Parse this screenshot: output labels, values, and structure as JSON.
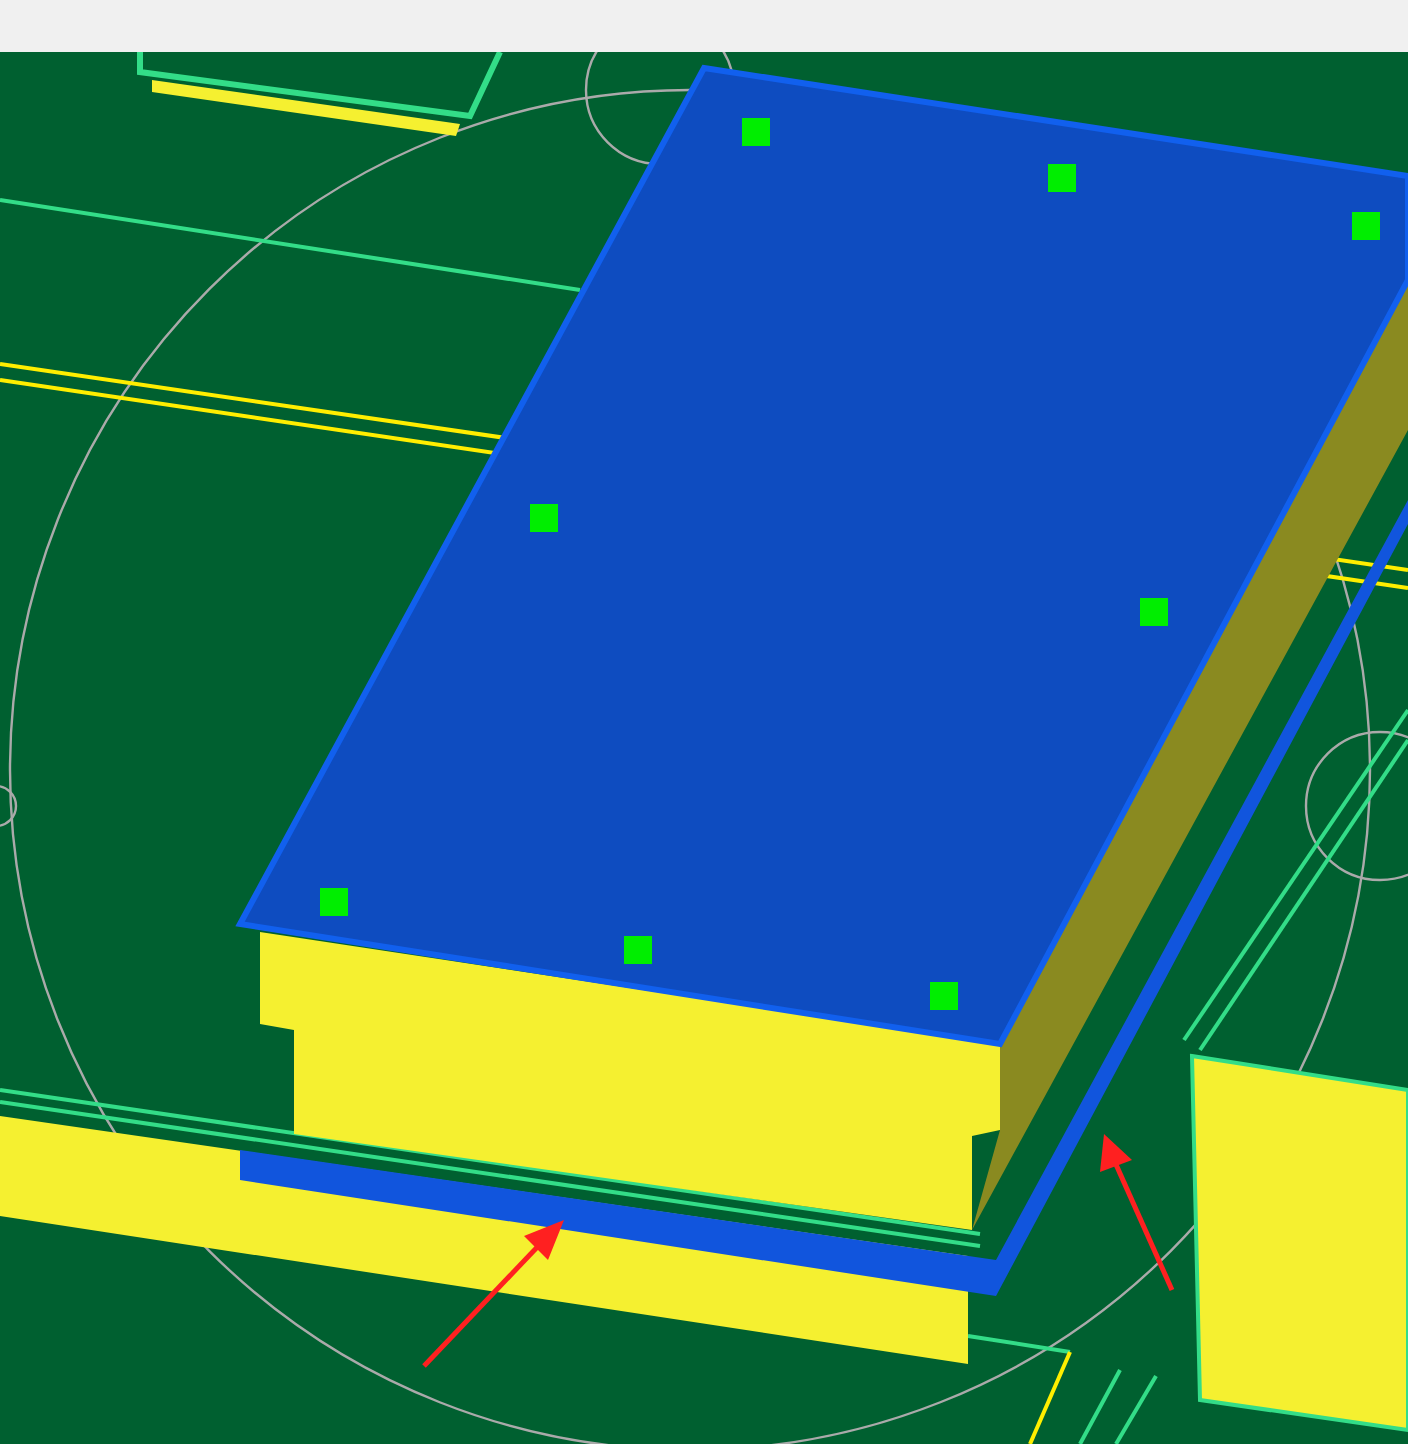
{
  "viewport": {
    "kind": "scene"
  }
}
